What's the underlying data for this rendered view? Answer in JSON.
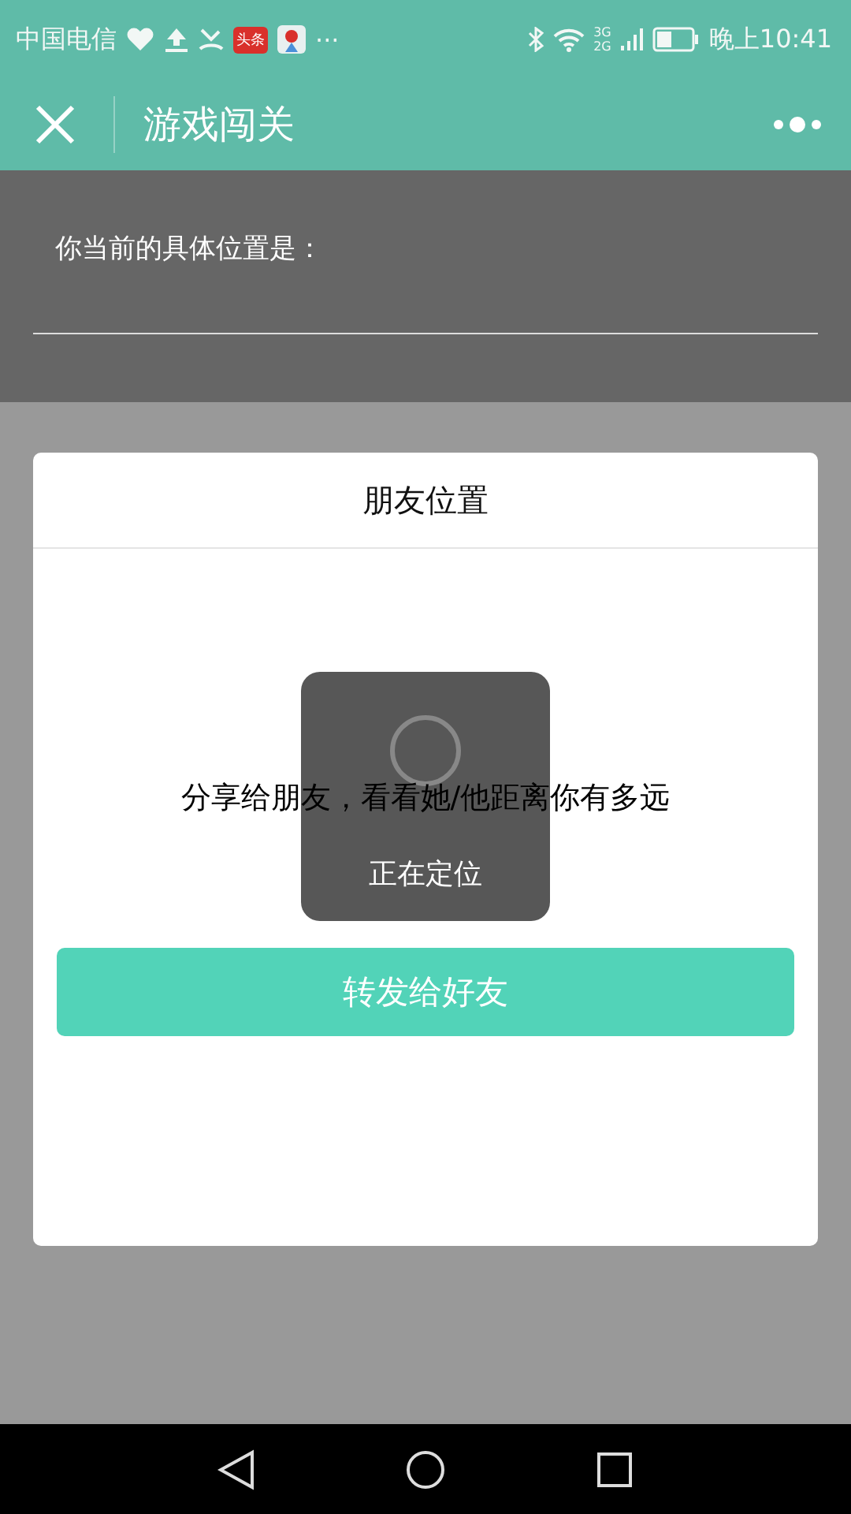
{
  "status_bar": {
    "carrier": "中国电信",
    "app_badge": "头条",
    "more": "···",
    "network_top": "3G",
    "network_bottom": "2G",
    "time": "晚上10:41"
  },
  "nav_bar": {
    "title": "游戏闯关"
  },
  "location": {
    "label": "你当前的具体位置是："
  },
  "dialog": {
    "title": "朋友位置",
    "message": "分享给朋友，看看她/他距离你有多远",
    "button": "转发给好友"
  },
  "toast": {
    "text": "正在定位"
  }
}
